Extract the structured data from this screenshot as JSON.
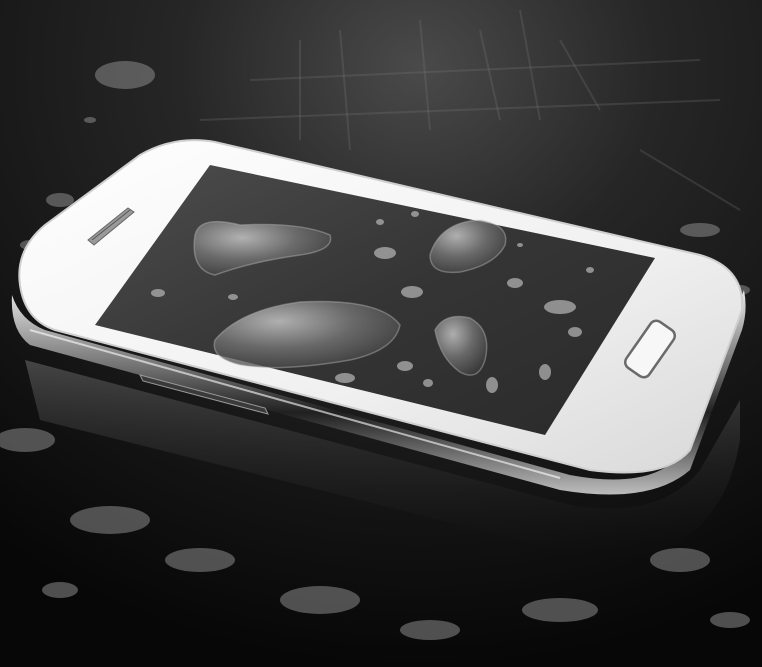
{
  "colors": {
    "surface": "#111111",
    "surface_highlight": "#5a5a5a",
    "phone_body": "#f2f2f2",
    "phone_bezel_chrome": "#c9c9c9",
    "screen": "#3c3c3c",
    "water": "#9a9a9a"
  },
  "icons": {
    "earpiece": "speaker-grille-icon",
    "home_button": "home-button-icon"
  }
}
